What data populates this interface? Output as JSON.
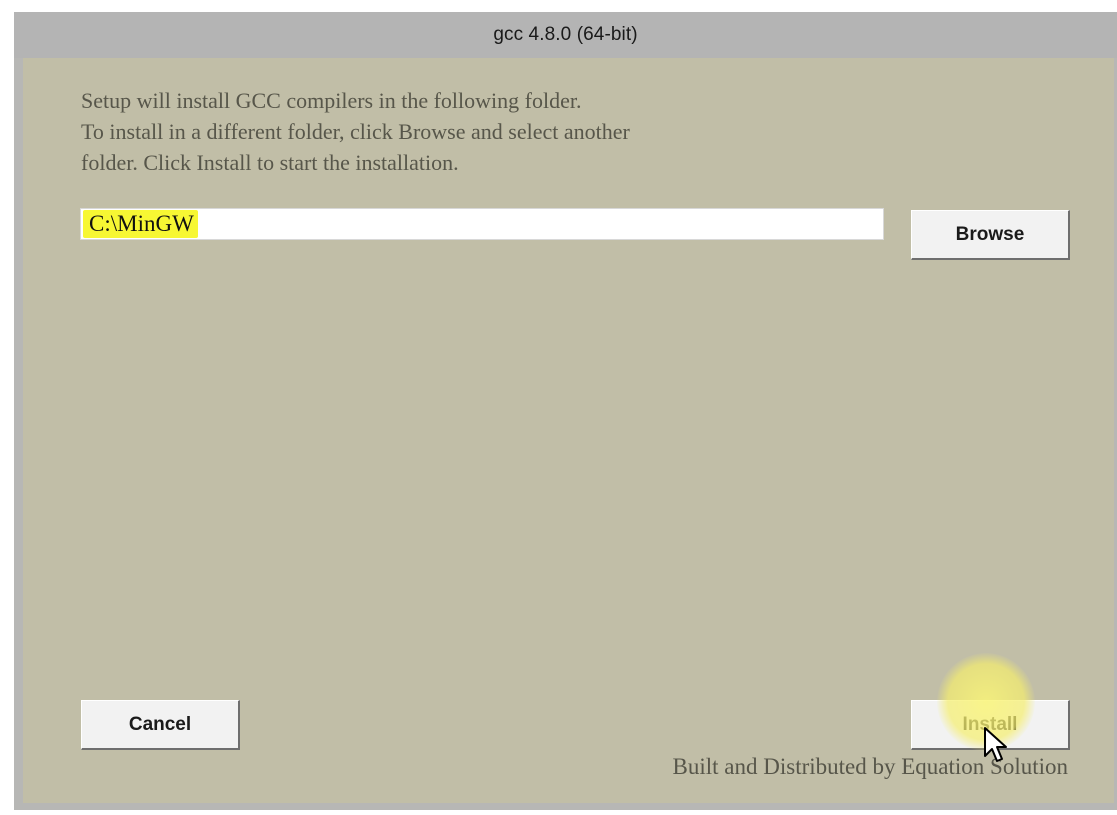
{
  "window": {
    "title": "gcc 4.8.0 (64-bit)"
  },
  "instructions": {
    "line1": "Setup will install GCC compilers in the following folder.",
    "line2": "To install in a different folder, click Browse and select another",
    "line3": "folder. Click Install to start the installation."
  },
  "path_field": {
    "value": "C:\\MinGW"
  },
  "buttons": {
    "browse": "Browse",
    "cancel": "Cancel",
    "install": "Install"
  },
  "footer": {
    "credit": "Built and Distributed by Equation Solution"
  },
  "colors": {
    "client_background": "#c1bea7",
    "highlight": "#f7f733",
    "button_face": "#f2f2f2"
  },
  "icons": {
    "cursor": "mouse-pointer-icon"
  }
}
